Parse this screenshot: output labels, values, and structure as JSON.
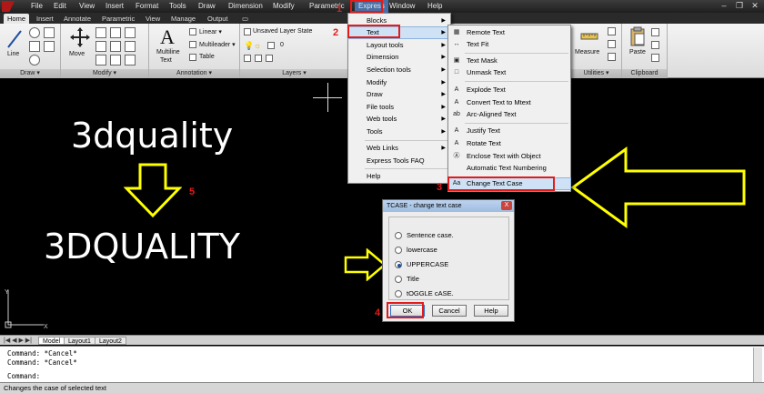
{
  "menubar": {
    "items": [
      "File",
      "Edit",
      "View",
      "Insert",
      "Format",
      "Tools",
      "Draw",
      "Dimension",
      "Modify",
      "Parametric",
      "Express",
      "Window",
      "Help"
    ],
    "active": "Express"
  },
  "ribbon_tabs": [
    "Home",
    "Insert",
    "Annotate",
    "Parametric",
    "View",
    "Manage",
    "Output"
  ],
  "ribbon": {
    "draw_panel": {
      "title": "Draw ▾",
      "line_label": "Line"
    },
    "modify_panel": {
      "title": "Modify ▾",
      "move_label": "Move"
    },
    "annotation_panel": {
      "title": "Annotation ▾",
      "multiline_label": "Multiline",
      "text_label": "Text",
      "linear_label": "Linear ▾",
      "multileader_label": "Multileader ▾",
      "table_label": "Table"
    },
    "layers_panel": {
      "title": "Layers ▾",
      "layer_state": "Unsaved Layer State",
      "current_layer": "0"
    },
    "utilities_panel": {
      "title": "Utilities ▾",
      "measure_label": "Measure"
    },
    "clipboard_panel": {
      "title": "Clipboard",
      "paste_label": "Paste"
    }
  },
  "express_menu": {
    "items": [
      "Blocks",
      "Text",
      "Layout tools",
      "Dimension",
      "Selection tools",
      "Modify",
      "Draw",
      "File tools",
      "Web tools",
      "Tools",
      "Web Links",
      "Express Tools FAQ",
      "Help"
    ],
    "highlighted": "Text"
  },
  "text_submenu": {
    "items": [
      "Remote Text",
      "Text Fit",
      "Text Mask",
      "Unmask Text",
      "Explode Text",
      "Convert Text to Mtext",
      "Arc-Aligned Text",
      "Justify Text",
      "Rotate Text",
      "Enclose Text with Object",
      "Automatic Text Numbering",
      "Change Text Case"
    ],
    "highlighted": "Change Text Case"
  },
  "dialog": {
    "title": "TCASE - change text case",
    "close_label": "X",
    "options": [
      "Sentence case.",
      "lowercase",
      "UPPERCASE",
      "Title",
      "tOGGLE cASE."
    ],
    "selected": "UPPERCASE",
    "ok_label": "OK",
    "cancel_label": "Cancel",
    "help_label": "Help"
  },
  "canvas": {
    "before_text": "3dquality",
    "after_text": "3DQUALITY"
  },
  "callouts": [
    "1",
    "2",
    "3",
    "4",
    "5"
  ],
  "layout_tabs": [
    "Model",
    "Layout1",
    "Layout2"
  ],
  "command_lines": [
    "Command: *Cancel*",
    "Command: *Cancel*",
    "Command:"
  ],
  "status_text": "Changes the case of selected text",
  "colors": {
    "callout_red": "#e21b1b",
    "arrow_yellow": "#ffff00",
    "highlight_blue": "#cfe2f5"
  }
}
